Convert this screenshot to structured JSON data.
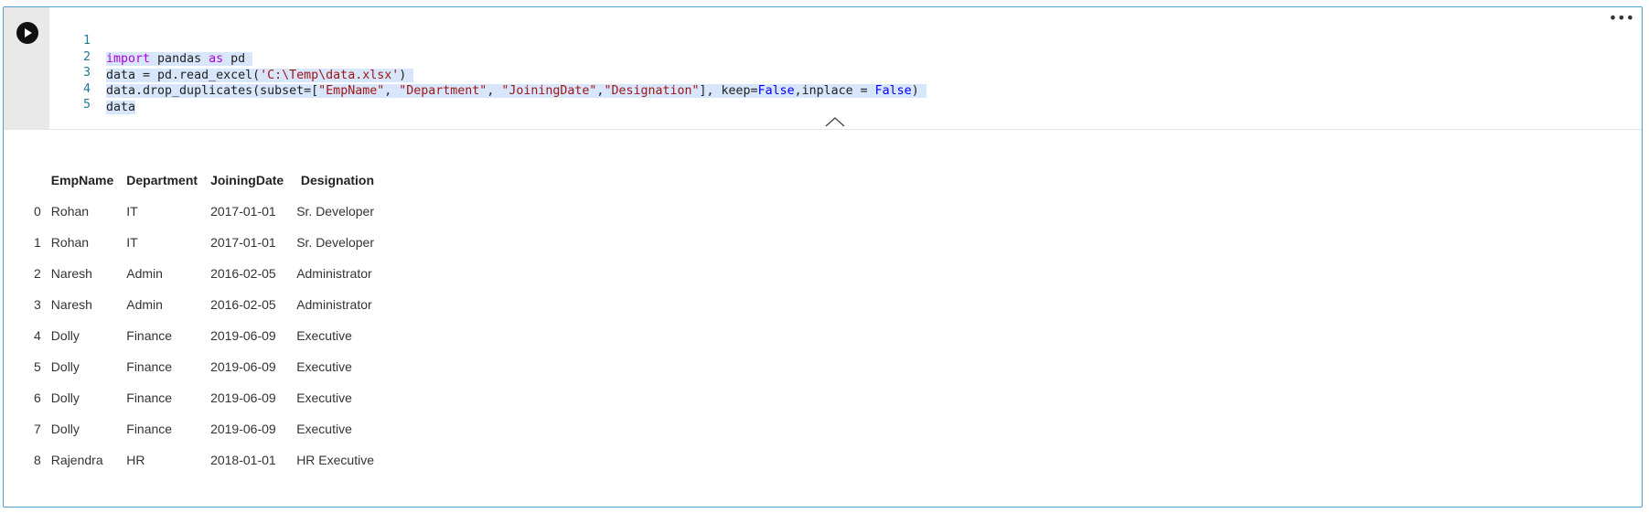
{
  "cell": {
    "run_icon": "play-icon",
    "more_icon": "ellipsis-icon",
    "more_label": "•••",
    "collapse_icon": "chevron-up-icon"
  },
  "code_lines": [
    {
      "num": "1",
      "text": "import pandas as pd"
    },
    {
      "num": "2",
      "text": "data = pd.read_excel('C:\\Temp\\data.xlsx')"
    },
    {
      "num": "3",
      "text": "data.drop_duplicates(subset=[\"EmpName\", \"Department\", \"JoiningDate\",\"Designation\"], keep=False,inplace = False)"
    },
    {
      "num": "4",
      "text": "data"
    },
    {
      "num": "5",
      "text": ""
    }
  ],
  "output": {
    "columns": [
      "",
      "EmpName",
      "Department",
      "JoiningDate",
      "Designation"
    ],
    "rows": [
      [
        "0",
        "Rohan",
        "IT",
        "2017-01-01",
        "Sr. Developer"
      ],
      [
        "1",
        "Rohan",
        "IT",
        "2017-01-01",
        "Sr. Developer"
      ],
      [
        "2",
        "Naresh",
        "Admin",
        "2016-02-05",
        "Administrator"
      ],
      [
        "3",
        "Naresh",
        "Admin",
        "2016-02-05",
        "Administrator"
      ],
      [
        "4",
        "Dolly",
        "Finance",
        "2019-06-09",
        "Executive"
      ],
      [
        "5",
        "Dolly",
        "Finance",
        "2019-06-09",
        "Executive"
      ],
      [
        "6",
        "Dolly",
        "Finance",
        "2019-06-09",
        "Executive"
      ],
      [
        "7",
        "Dolly",
        "Finance",
        "2019-06-09",
        "Executive"
      ],
      [
        "8",
        "Rajendra",
        "HR",
        "2018-01-01",
        "HR Executive"
      ]
    ]
  },
  "colors": {
    "cell_border": "#4d9fd6",
    "selection": "#d7e6fb",
    "keyword": "#af00db",
    "string": "#a31515",
    "boolean": "#0000ff",
    "line_number": "#237893"
  }
}
